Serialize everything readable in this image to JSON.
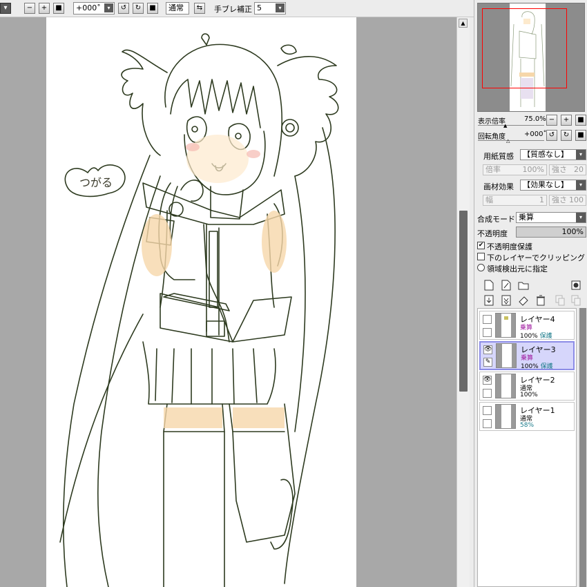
{
  "toolbar": {
    "rotation_value": "+000˚",
    "blend_mode": "通常",
    "stabilizer_label": "手ブレ補正",
    "stabilizer_value": "5"
  },
  "navigator": {
    "zoom_label": "表示倍率",
    "zoom_value": "75.0%",
    "rotation_label": "回転角度",
    "rotation_value": "+000˚"
  },
  "paper_texture": {
    "label": "用紙質感",
    "value": "【質感なし】",
    "scale_label": "倍率",
    "scale_value": "100%",
    "strength_label": "強さ",
    "strength_value": "20"
  },
  "brush_effect": {
    "label": "画材効果",
    "value": "【効果なし】",
    "width_label": "幅",
    "width_value": "1",
    "strength_label": "強さ",
    "strength_value": "100"
  },
  "layer_props": {
    "blend_label": "合成モード",
    "blend_value": "乗算",
    "opacity_label": "不透明度",
    "opacity_value": "100%",
    "protect_opacity_label": "不透明度保護",
    "protect_opacity_checked": true,
    "clip_label": "下のレイヤーでクリッピング",
    "region_label": "領域検出元に指定"
  },
  "layers": [
    {
      "name": "レイヤー4",
      "mode": "乗算",
      "opacity": "100%",
      "protect": "保護",
      "visible": false,
      "selected": false
    },
    {
      "name": "レイヤー3",
      "mode": "乗算",
      "opacity": "100%",
      "protect": "保護",
      "visible": true,
      "selected": true
    },
    {
      "name": "レイヤー2",
      "mode": "通常",
      "opacity": "100%",
      "protect": "",
      "visible": true,
      "selected": false
    },
    {
      "name": "レイヤー1",
      "mode": "通常",
      "opacity": "58%",
      "protect": "",
      "visible": false,
      "selected": false
    }
  ],
  "canvas": {
    "drawing_text": "つがる"
  },
  "colors": {
    "selected_layer": "#d6d6fb",
    "blend_mode_multiply": "#a01ca0",
    "protect_text": "#1a7a8a",
    "navigator_frame": "#ff0000"
  }
}
